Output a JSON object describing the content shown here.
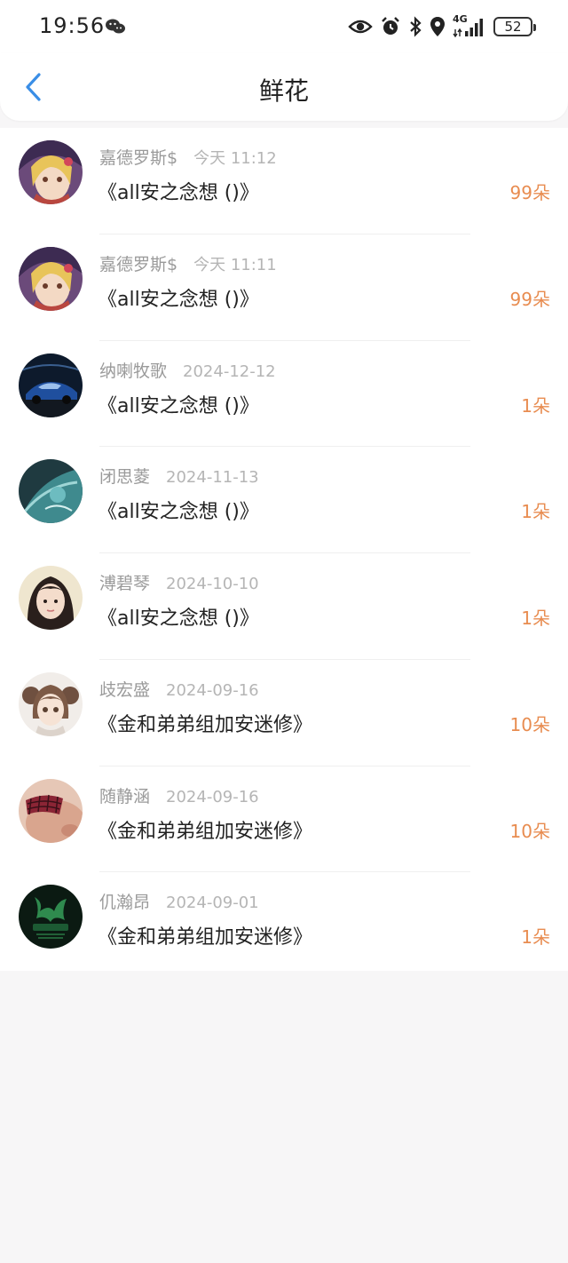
{
  "status_bar": {
    "time": "19:56",
    "icons": [
      "wechat-icon",
      "eye-icon",
      "alarm-icon",
      "bluetooth-icon",
      "location-icon",
      "signal-4g-icon"
    ],
    "network_label": "4G",
    "battery": "52"
  },
  "header": {
    "back_icon": "chevron-left-icon",
    "title": "鲜花"
  },
  "colors": {
    "accent_blue": "#3a8ee6",
    "count_orange": "#e88c50",
    "name_gray": "#9a9a9a",
    "time_gray": "#b5b5b5"
  },
  "rows": [
    {
      "name": "嘉德罗斯$",
      "time": "今天 11:12",
      "book": "《all安之念想 ()》",
      "count": "99朵",
      "avatar": "anime-girl-avatar"
    },
    {
      "name": "嘉德罗斯$",
      "time": "今天 11:11",
      "book": "《all安之念想 ()》",
      "count": "99朵",
      "avatar": "anime-girl-avatar"
    },
    {
      "name": "纳喇牧歌",
      "time": "2024-12-12",
      "book": "《all安之念想 ()》",
      "count": "1朵",
      "avatar": "blue-car-avatar"
    },
    {
      "name": "闭思菱",
      "time": "2024-11-13",
      "book": "《all安之念想 ()》",
      "count": "1朵",
      "avatar": "teal-abstract-avatar"
    },
    {
      "name": "溥碧琴",
      "time": "2024-10-10",
      "book": "《all安之念想 ()》",
      "count": "1朵",
      "avatar": "girl-photo-avatar"
    },
    {
      "name": "歧宏盛",
      "time": "2024-09-16",
      "book": "《金和弟弟组加安迷修》",
      "count": "10朵",
      "avatar": "anime-girl-pigtails-avatar"
    },
    {
      "name": "随静涵",
      "time": "2024-09-16",
      "book": "《金和弟弟组加安迷修》",
      "count": "10朵",
      "avatar": "plaid-photo-avatar"
    },
    {
      "name": "仉瀚昂",
      "time": "2024-09-01",
      "book": "《金和弟弟组加安迷修》",
      "count": "1朵",
      "avatar": "dark-green-logo-avatar"
    }
  ]
}
